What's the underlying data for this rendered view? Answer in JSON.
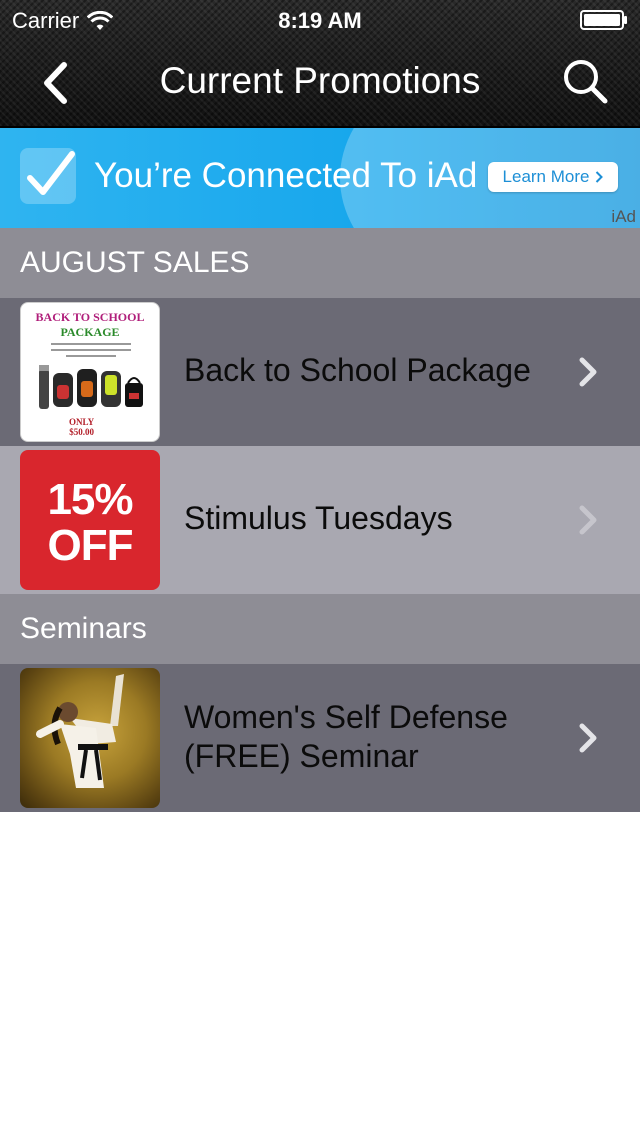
{
  "status_bar": {
    "carrier": "Carrier",
    "time": "8:19 AM"
  },
  "nav": {
    "title": "Current Promotions",
    "back_icon": "chevron-left-icon",
    "search_icon": "search-icon"
  },
  "ad": {
    "text": "You’re Connected To iAd",
    "button_label": "Learn More",
    "badge": "iAd"
  },
  "sections": [
    {
      "header": "AUGUST SALES",
      "items": [
        {
          "label": "Back to School Package",
          "thumb_lines": [
            "BACK TO SCHOOL",
            "PACKAGE",
            "ONLY",
            "$50.00"
          ]
        },
        {
          "label": "Stimulus Tuesdays",
          "thumb_lines": [
            "15%",
            "OFF"
          ]
        }
      ]
    },
    {
      "header": "Seminars",
      "items": [
        {
          "label": "Women's Self Defense (FREE) Seminar"
        }
      ]
    }
  ],
  "colors": {
    "section_header": "#8e8d95",
    "row_dark": "#6b6a75",
    "row_light": "#a9a8b1",
    "ad_blue": "#16a6ec",
    "offer_red": "#d9262d"
  }
}
